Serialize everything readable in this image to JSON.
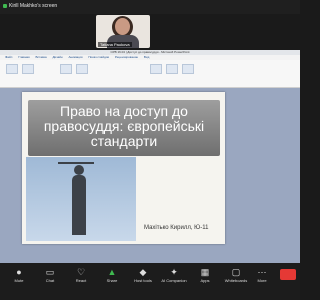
{
  "top_bar": {
    "screen_share_label": "Kirill Makhko's screen"
  },
  "participant": {
    "name": "Tatiana Paukova"
  },
  "powerpoint": {
    "window_title": "CPB 16.04 | Доступ до правосуддя - Microsoft PowerPoint",
    "tabs": [
      "Файл",
      "Главная",
      "Вставка",
      "Дизайн",
      "Анимация",
      "Показ слайдов",
      "Рецензирование",
      "Вид"
    ]
  },
  "slide": {
    "title": "Право на доступ до правосуддя: європейські стандарти",
    "author": "Махітько Кирилл, Ю-11"
  },
  "toolbar": {
    "items": [
      {
        "label": "Mute",
        "icon": "microphone-icon"
      },
      {
        "label": "Chat",
        "icon": "chat-icon"
      },
      {
        "label": "React",
        "icon": "heart-icon"
      },
      {
        "label": "Share",
        "icon": "share-icon"
      },
      {
        "label": "Host tools",
        "icon": "shield-icon"
      },
      {
        "label": "AI Companion",
        "icon": "sparkle-icon"
      },
      {
        "label": "Apps",
        "icon": "apps-icon"
      },
      {
        "label": "Whiteboards",
        "icon": "whiteboard-icon"
      },
      {
        "label": "More",
        "icon": "more-icon"
      }
    ]
  },
  "colors": {
    "share_active": "#3fb950",
    "end_button": "#e53935"
  }
}
